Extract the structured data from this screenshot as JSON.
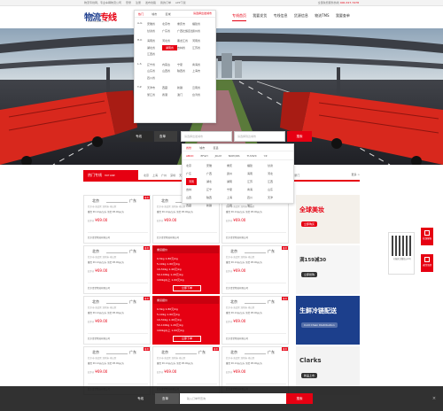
{
  "topbar": {
    "left": [
      "物流专线网，专业车辆物流公司",
      "登录",
      "注册",
      "发布线路",
      "我的订单",
      "APP下载"
    ],
    "right_hot": "全国免费服务热线",
    "phone": "400-327-7478"
  },
  "logo": {
    "text_a": "物流",
    "text_b": "专线",
    "slogan": "WULIUZHUANXIAN.COM"
  },
  "nav": [
    "专线首页",
    "我要发货",
    "专线信息",
    "货源信息",
    "物流TMS",
    "我要查单"
  ],
  "citypop": {
    "tabs": [
      "热门",
      "城市",
      "区域"
    ],
    "hot": "请选择出发城市",
    "groups": [
      {
        "label": "A-G",
        "cities": [
          "安徽省",
          "北京市",
          "重庆市",
          "福建省",
          "甘肃省",
          "广东省",
          "广西壮族自治区",
          "贵州省"
        ]
      },
      {
        "label": "H-K",
        "cities": [
          "海南省",
          "河北省",
          "黑龙江省",
          "河南省",
          "湖北省",
          "湖南省",
          "吉林省",
          "江苏省",
          "江西省"
        ]
      },
      {
        "label": "L-S",
        "cities": [
          "辽宁省",
          "内蒙古",
          "宁夏",
          "青海省",
          "山东省",
          "山西省",
          "陕西省",
          "上海市",
          "四川省"
        ]
      },
      {
        "label": "T-Z",
        "cities": [
          "天津市",
          "西藏",
          "新疆",
          "云南省",
          "浙江省",
          "香港",
          "澳门",
          "台湾省"
        ]
      }
    ]
  },
  "search": {
    "tab_line": "专线",
    "tab_order": "查单",
    "from_placeholder": "请选择出发城市",
    "to_placeholder": "请选择到达城市",
    "button": "搜索"
  },
  "letterpop": {
    "tabs": [
      "省份",
      "城市",
      "区县"
    ],
    "letters": [
      "ABCD",
      "EFGH",
      "JKLM",
      "NOPQRS",
      "TUVWX",
      "YZ"
    ],
    "cities": [
      "北京",
      "安徽",
      "重庆",
      "福建",
      "甘肃",
      "广东",
      "广西",
      "贵州",
      "海南",
      "河北",
      "河南",
      "湖北",
      "湖南",
      "江苏",
      "江西",
      "吉林",
      "辽宁",
      "宁夏",
      "青海",
      "山东",
      "山西",
      "陕西",
      "上海",
      "四川",
      "天津",
      "西藏",
      "新疆",
      "云南",
      "浙江"
    ],
    "selected": "河南"
  },
  "section": {
    "title": "热门专线",
    "title_en": "HOT LINE",
    "tabs": [
      "北京",
      "上海",
      "广州",
      "深圳",
      "天津",
      "重庆",
      "杭州",
      "南京",
      "成都",
      "武汉",
      "西安",
      "长沙",
      "郑州",
      "济南",
      "苏州",
      "合肥",
      "福州",
      "厦门"
    ],
    "more": "更多 >"
  },
  "cards": [
    {
      "type": "route",
      "from": "北京",
      "to": "广东",
      "tag": "推荐",
      "sub": "北京市·海淀区",
      "sub_to": "深圳市·南山区",
      "price": "重货 ¥0.12元/公斤  泡货 ¥8.00元/方",
      "min": "起步价",
      "min_val": "¥69.00",
      "company": "北京青蒙物流有限公司"
    },
    {
      "type": "route",
      "from": "北京",
      "to": "广东",
      "tag": "推荐",
      "sub": "北京市·海淀区",
      "sub_to": "深圳市·南山区",
      "price": "重货 ¥0.12元/公斤  泡货 ¥8.00元/方",
      "min": "起步价",
      "min_val": "¥69.00",
      "company": "北京青蒙物流有限公司"
    },
    {
      "type": "route",
      "from": "北京",
      "to": "广东",
      "tag": "推荐",
      "sub": "北京市·海淀区",
      "sub_to": "深圳市·南山区",
      "price": "重货 ¥0.12元/公斤  泡货 ¥8.00元/方",
      "min": "起步价",
      "min_val": "¥69.00",
      "company": "北京青蒙物流有限公司"
    },
    {
      "type": "route",
      "from": "北京",
      "to": "广东",
      "tag": "推荐",
      "sub": "北京市·海淀区",
      "sub_to": "深圳市·南山区",
      "price": "重货 ¥0.12元/公斤  泡货 ¥8.00元/方",
      "min": "起步价",
      "min_val": "¥69.00",
      "company": "北京青蒙物流有限公司"
    },
    {
      "type": "rate",
      "head": "重货报价",
      "lines": [
        "0-5kg  1.80元/kg",
        "5-10kg  1.60元/kg",
        "10-50kg  1.40元/kg",
        "50-100kg  1.20元/kg",
        "100kg以上  1.00元/kg"
      ],
      "button": "立即下单"
    },
    {
      "type": "route",
      "from": "北京",
      "to": "广东",
      "tag": "推荐",
      "sub": "北京市·海淀区",
      "sub_to": "深圳市·南山区",
      "price": "重货 ¥0.12元/公斤  泡货 ¥8.00元/方",
      "min": "起步价",
      "min_val": "¥69.00",
      "company": "北京青蒙物流有限公司"
    },
    {
      "type": "route",
      "from": "北京",
      "to": "广东",
      "tag": "推荐",
      "sub": "北京市·海淀区",
      "sub_to": "深圳市·南山区",
      "price": "重货 ¥0.12元/公斤  泡货 ¥8.00元/方",
      "min": "起步价",
      "min_val": "¥69.00",
      "company": "北京青蒙物流有限公司"
    },
    {
      "type": "rate",
      "head": "重货报价",
      "lines": [
        "0-5kg  1.80元/kg",
        "5-10kg  1.60元/kg",
        "10-50kg  1.40元/kg",
        "50-100kg  1.20元/kg",
        "100kg以上  1.00元/kg"
      ],
      "button": "立即下单"
    },
    {
      "type": "route",
      "from": "北京",
      "to": "广东",
      "tag": "推荐",
      "sub": "北京市·海淀区",
      "sub_to": "深圳市·南山区",
      "price": "重货 ¥0.12元/公斤  泡货 ¥8.00元/方",
      "min": "起步价",
      "min_val": "¥69.00",
      "company": "北京青蒙物流有限公司"
    },
    {
      "type": "route",
      "from": "北京",
      "to": "广东",
      "tag": "推荐",
      "sub": "北京市·海淀区",
      "sub_to": "深圳市·南山区",
      "price": "重货 ¥0.12元/公斤  泡货 ¥8.00元/方",
      "min": "起步价",
      "min_val": "¥69.00",
      "company": "北京青蒙物流有限公司"
    },
    {
      "type": "route",
      "from": "北京",
      "to": "广东",
      "tag": "推荐",
      "sub": "北京市·海淀区",
      "sub_to": "深圳市·南山区",
      "price": "重货 ¥0.12元/公斤  泡货 ¥8.00元/方",
      "min": "起步价",
      "min_val": "¥69.00",
      "company": "北京青蒙物流有限公司"
    },
    {
      "type": "route",
      "from": "北京",
      "to": "广东",
      "tag": "推荐",
      "sub": "北京市·海淀区",
      "sub_to": "深圳市·南山区",
      "price": "重货 ¥0.12元/公斤  泡货 ¥8.00元/方",
      "min": "起步价",
      "min_val": "¥69.00",
      "company": "北京青蒙物流有限公司"
    }
  ],
  "ads": [
    {
      "title": "全球美妆",
      "badge": "立即购买",
      "color": "#e60012",
      "bg": "#f4f0ea"
    },
    {
      "title": "满159减30",
      "badge": "立即抢购",
      "color": "#333333",
      "bg": "#f6f6f6"
    },
    {
      "title": "生鲜冷链配送",
      "badge": "Cold Chain Distribution",
      "color": "#ffffff",
      "bg": "#1c3f8c"
    },
    {
      "title": "Clarks",
      "badge": "新品上市",
      "color": "#333333",
      "bg": "#f3f3f3"
    }
  ],
  "float": {
    "qr_text": "扫描关注微信公众号",
    "btn1": "在线客服",
    "btn2": "返回顶部"
  },
  "bottombar": {
    "tab_line": "专线",
    "tab_order": "查单",
    "placeholder": "输入订单号查询",
    "button": "搜索"
  }
}
